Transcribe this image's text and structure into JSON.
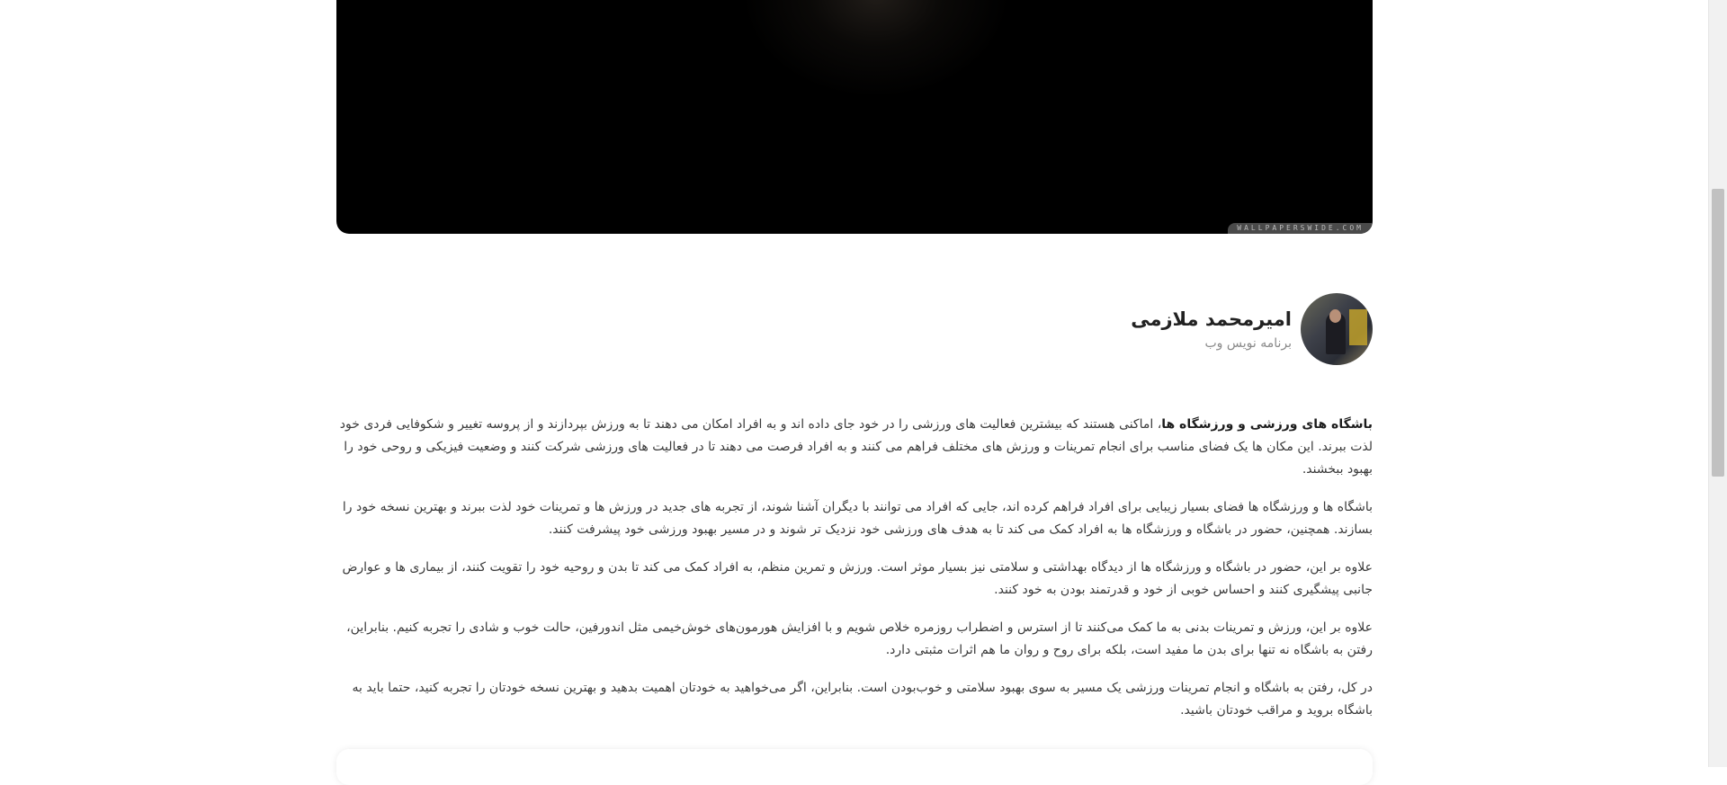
{
  "hero": {
    "watermark": "WALLPAPERSWIDE.COM"
  },
  "author": {
    "name": "امیرمحمد ملازمی",
    "role": "برنامه نویس وب"
  },
  "article": {
    "p1_bold": "باشگاه های ورزشی و ورزشگاه ها",
    "p1_rest": "، اماکنی هستند که بیشترین فعالیت های ورزشی را در خود جای داده اند و به افراد امکان می دهند تا به ورزش بپردازند و از پروسه تغییر و شکوفایی فردی خود لذت ببرند. این مکان ها یک فضای مناسب برای انجام تمرینات و ورزش های مختلف فراهم می کنند و به افراد فرصت می دهند تا در فعالیت های ورزشی شرکت کنند و وضعیت فیزیکی و روحی خود را بهبود ببخشند.",
    "p2": "باشگاه ها و ورزشگاه ها فضای بسیار زیبایی برای افراد فراهم کرده اند، جایی که افراد می توانند با دیگران آشنا شوند، از تجربه های جدید در ورزش ها و تمرینات خود لذت ببرند و بهترین نسخه خود را بسازند. همچنین، حضور در باشگاه و ورزشگاه ها به افراد کمک می کند تا به هدف های ورزشی خود نزدیک تر شوند و در مسیر بهبود ورزشی خود پیشرفت کنند.",
    "p3": "علاوه بر این، حضور در باشگاه و ورزشگاه ها از دیدگاه بهداشتی و سلامتی نیز بسیار موثر است. ورزش و تمرین منظم، به افراد کمک می کند تا بدن و روحیه خود را تقویت کنند، از بیماری ها و عوارض جانبی پیشگیری کنند و احساس خوبی از خود و قدرتمند بودن به خود کنند.",
    "p4": "علاوه بر این، ورزش و تمرینات بدنی به ما کمک می‌کنند تا از استرس و اضطراب روزمره خلاص شویم و با افزایش هورمون‌های خوش‌خیمی مثل اندورفین، حالت خوب و شادی را تجربه کنیم. بنابراین، رفتن به باشگاه نه تنها برای بدن ما مفید است، بلکه برای روح و روان ما هم اثرات مثبتی دارد.",
    "p5": "در کل، رفتن به باشگاه و انجام تمرینات ورزشی یک مسیر به سوی بهبود سلامتی و خوب‌بودن است. بنابراین، اگر می‌خواهید به خودتان اهمیت بدهید و بهترین نسخه خودتان را تجربه کنید، حتما باید به باشگاه بروید و مراقب خودتان باشید."
  }
}
